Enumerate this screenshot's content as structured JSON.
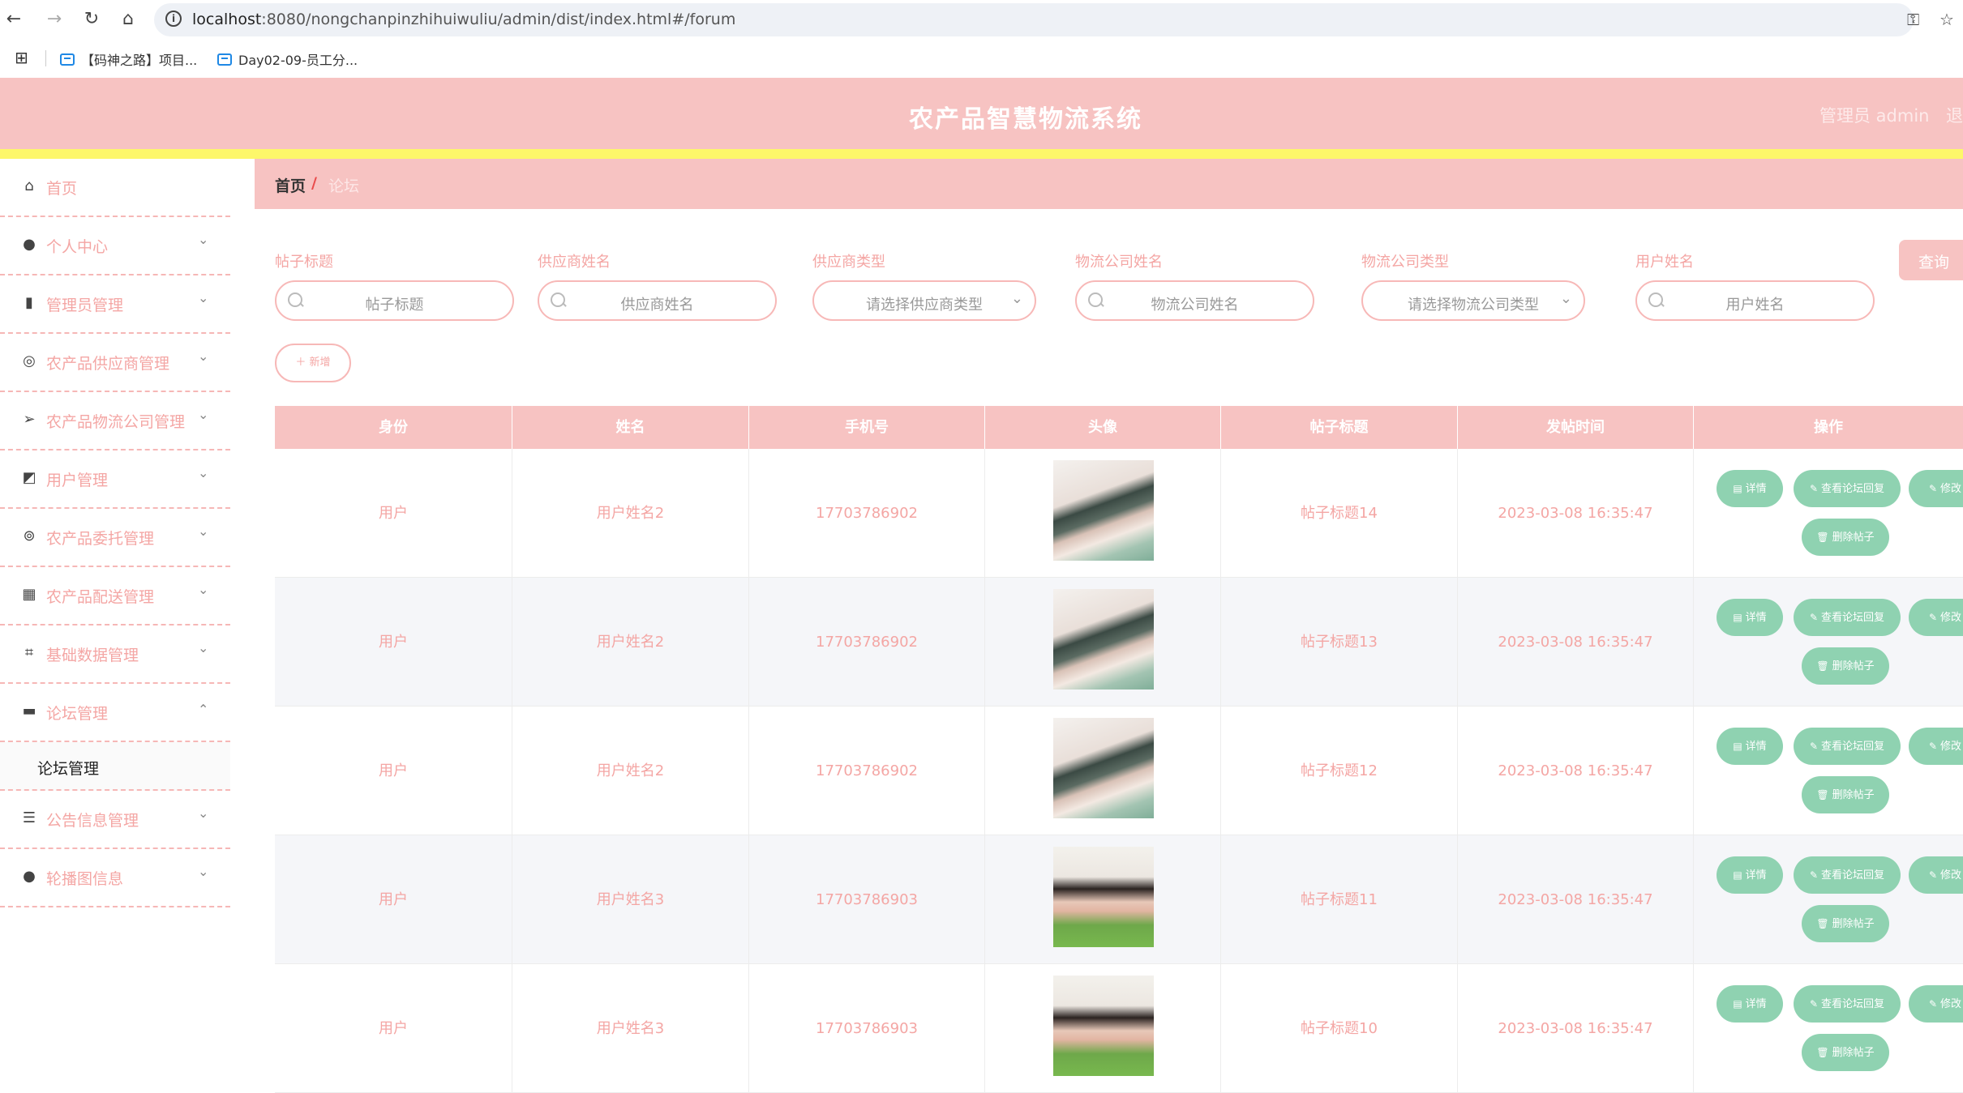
{
  "browser": {
    "url_host": "localhost",
    "url_rest": ":8080/nongchanpinzhihuiwuliu/admin/dist/index.html#/forum",
    "bookmarks": [
      "【码神之路】项目...",
      "Day02-09-员工分..."
    ]
  },
  "header": {
    "title": "农产品智慧物流系统",
    "user": "管理员 admin",
    "logout": "退"
  },
  "sidebar": {
    "items": [
      {
        "label": "首页",
        "icon": "home-icon",
        "has_arrow": false
      },
      {
        "label": "个人中心",
        "icon": "user-icon",
        "has_arrow": true
      },
      {
        "label": "管理员管理",
        "icon": "books-icon",
        "has_arrow": true
      },
      {
        "label": "农产品供应商管理",
        "icon": "compass-icon",
        "has_arrow": true
      },
      {
        "label": "农产品物流公司管理",
        "icon": "send-icon",
        "has_arrow": true
      },
      {
        "label": "用户管理",
        "icon": "chart-icon",
        "has_arrow": true
      },
      {
        "label": "农产品委托管理",
        "icon": "lifebuoy-icon",
        "has_arrow": true
      },
      {
        "label": "农产品配送管理",
        "icon": "grid-icon",
        "has_arrow": true
      },
      {
        "label": "基础数据管理",
        "icon": "crop-icon",
        "has_arrow": true
      },
      {
        "label": "论坛管理",
        "icon": "briefcase-icon",
        "has_arrow": true,
        "expanded": true
      },
      {
        "label": "公告信息管理",
        "icon": "sliders-icon",
        "has_arrow": true
      },
      {
        "label": "轮播图信息",
        "icon": "balloon-icon",
        "has_arrow": true
      }
    ],
    "submenu_label": "论坛管理"
  },
  "breadcrumb": {
    "home": "首页",
    "separator": "/",
    "current": "论坛"
  },
  "search": {
    "fields": [
      {
        "label": "帖子标题",
        "placeholder": "帖子标题",
        "type": "input"
      },
      {
        "label": "供应商姓名",
        "placeholder": "供应商姓名",
        "type": "input"
      },
      {
        "label": "供应商类型",
        "placeholder": "请选择供应商类型",
        "type": "select"
      },
      {
        "label": "物流公司姓名",
        "placeholder": "物流公司姓名",
        "type": "input"
      },
      {
        "label": "物流公司类型",
        "placeholder": "请选择物流公司类型",
        "type": "select"
      },
      {
        "label": "用户姓名",
        "placeholder": "用户姓名",
        "type": "input"
      }
    ],
    "query_button": "查询",
    "add_button": "＋ 新增"
  },
  "table": {
    "headers": [
      "身份",
      "姓名",
      "手机号",
      "头像",
      "帖子标题",
      "发帖时间",
      "操作"
    ],
    "rows": [
      {
        "role": "用户",
        "name": "用户姓名2",
        "phone": "17703786902",
        "avatar": "avatar-a1",
        "title": "帖子标题14",
        "time": "2023-03-08 16:35:47"
      },
      {
        "role": "用户",
        "name": "用户姓名2",
        "phone": "17703786902",
        "avatar": "avatar-a1",
        "title": "帖子标题13",
        "time": "2023-03-08 16:35:47"
      },
      {
        "role": "用户",
        "name": "用户姓名2",
        "phone": "17703786902",
        "avatar": "avatar-a1",
        "title": "帖子标题12",
        "time": "2023-03-08 16:35:47"
      },
      {
        "role": "用户",
        "name": "用户姓名3",
        "phone": "17703786903",
        "avatar": "avatar-a2",
        "title": "帖子标题11",
        "time": "2023-03-08 16:35:47"
      },
      {
        "role": "用户",
        "name": "用户姓名3",
        "phone": "17703786903",
        "avatar": "avatar-a2",
        "title": "帖子标题10",
        "time": "2023-03-08 16:35:47"
      }
    ],
    "actions": {
      "detail": "详情",
      "reply": "查看论坛回复",
      "edit": "修改",
      "delete": "删除帖子"
    }
  },
  "colors": {
    "accent": "#f7c3c2",
    "strip": "#fdf76a",
    "action": "#8fd2b1",
    "text_pink": "#f4a6a4"
  }
}
